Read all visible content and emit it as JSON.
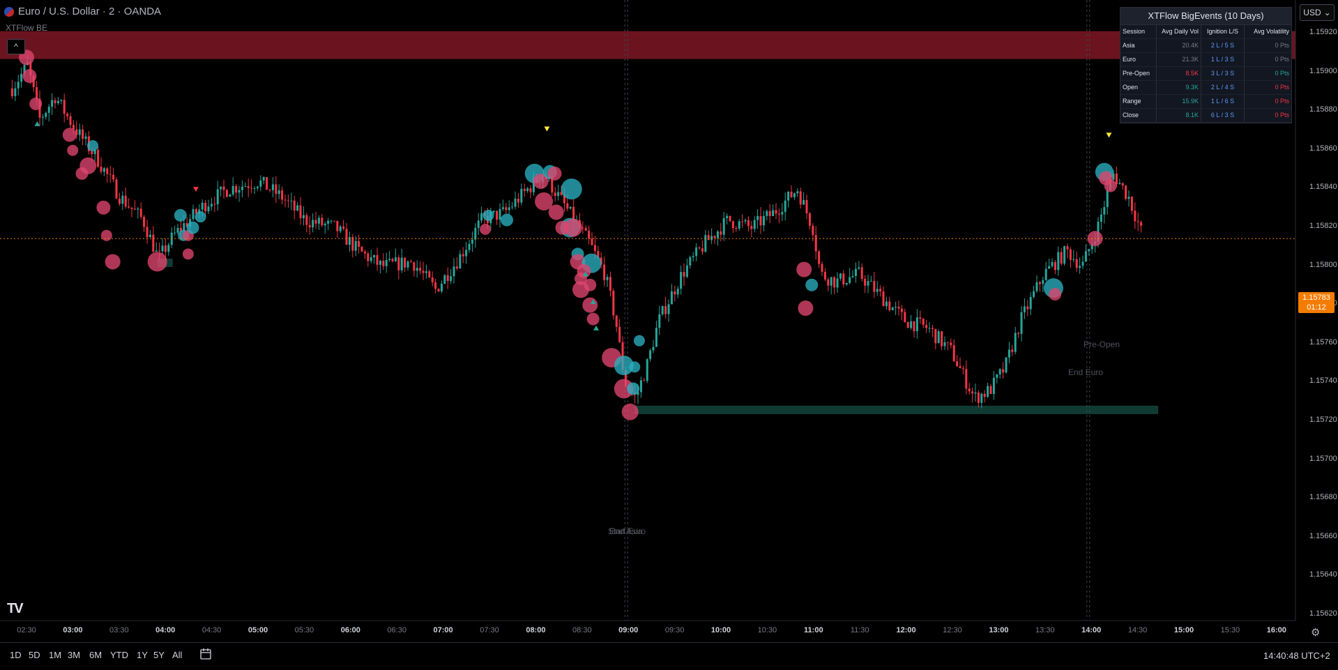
{
  "header": {
    "symbol_title": "Euro / U.S. Dollar · 2 · OANDA",
    "indicator_name": "XTFlow BE",
    "collapse_label": "^"
  },
  "currency_selector": {
    "value": "USD",
    "chevron": "⌄"
  },
  "price_axis": {
    "ticks": [
      "1.15920",
      "1.15900",
      "1.15880",
      "1.15860",
      "1.15840",
      "1.15820",
      "1.15800",
      "1.15780",
      "1.15760",
      "1.15740",
      "1.15720",
      "1.15700",
      "1.15680",
      "1.15660",
      "1.15640",
      "1.15620"
    ],
    "current_price": "1.15783",
    "countdown": "01:12"
  },
  "time_axis": {
    "ticks": [
      {
        "label": "02:30",
        "bold": false
      },
      {
        "label": "03:00",
        "bold": true
      },
      {
        "label": "03:30",
        "bold": false
      },
      {
        "label": "04:00",
        "bold": true
      },
      {
        "label": "04:30",
        "bold": false
      },
      {
        "label": "05:00",
        "bold": true
      },
      {
        "label": "05:30",
        "bold": false
      },
      {
        "label": "06:00",
        "bold": true
      },
      {
        "label": "06:30",
        "bold": false
      },
      {
        "label": "07:00",
        "bold": true
      },
      {
        "label": "07:30",
        "bold": false
      },
      {
        "label": "08:00",
        "bold": true
      },
      {
        "label": "08:30",
        "bold": false
      },
      {
        "label": "09:00",
        "bold": true
      },
      {
        "label": "09:30",
        "bold": false
      },
      {
        "label": "10:00",
        "bold": true
      },
      {
        "label": "10:30",
        "bold": false
      },
      {
        "label": "11:00",
        "bold": true
      },
      {
        "label": "11:30",
        "bold": false
      },
      {
        "label": "12:00",
        "bold": true
      },
      {
        "label": "12:30",
        "bold": false
      },
      {
        "label": "13:00",
        "bold": true
      },
      {
        "label": "13:30",
        "bold": false
      },
      {
        "label": "14:00",
        "bold": true
      },
      {
        "label": "14:30",
        "bold": false
      },
      {
        "label": "15:00",
        "bold": true
      },
      {
        "label": "15:30",
        "bold": false
      },
      {
        "label": "16:00",
        "bold": true
      }
    ]
  },
  "chart_labels": {
    "start_euro": "Start Euro",
    "end_asia": "End Asia",
    "pre_open": "Pre-Open",
    "end_euro": "End Euro"
  },
  "table": {
    "title": "XTFlow BigEvents (10 Days)",
    "headers": [
      "Session",
      "Avg Daily Vol",
      "Ignition L/S",
      "Avg Volatility"
    ],
    "rows": [
      {
        "session": "Asia",
        "vol": "20.4K",
        "vol_color": "#787b86",
        "ign": "2 L / 5 S",
        "vola": "0 Pts",
        "vola_color": "#787b86"
      },
      {
        "session": "Euro",
        "vol": "21.3K",
        "vol_color": "#787b86",
        "ign": "1 L / 3 S",
        "vola": "0 Pts",
        "vola_color": "#787b86"
      },
      {
        "session": "Pre-Open",
        "vol": "8.5K",
        "vol_color": "#f23645",
        "ign": "3 L / 3 S",
        "vola": "0 Pts",
        "vola_color": "#26a69a"
      },
      {
        "session": "Open",
        "vol": "9.3K",
        "vol_color": "#26a69a",
        "ign": "2 L / 4 S",
        "vola": "0 Pts",
        "vola_color": "#f23645"
      },
      {
        "session": "Range",
        "vol": "15.9K",
        "vol_color": "#26a69a",
        "ign": "1 L / 6 S",
        "vola": "0 Pts",
        "vola_color": "#f23645"
      },
      {
        "session": "Close",
        "vol": "8.1K",
        "vol_color": "#26a69a",
        "ign": "6 L / 3 S",
        "vola": "0 Pts",
        "vola_color": "#f23645"
      }
    ],
    "ign_color": "#5b9cf6"
  },
  "bottom_bar": {
    "ranges": [
      "1D",
      "5D",
      "1M",
      "3M",
      "6M",
      "YTD",
      "1Y",
      "5Y",
      "All"
    ],
    "clock": "14:40:48 UTC+2"
  },
  "colors": {
    "up": "#26a69a",
    "down": "#f23645",
    "bubble_red": "#e0456e",
    "bubble_teal": "#2ab0c0",
    "resistance_zone": "#6b1420",
    "support_zone": "#0f3b33",
    "current_price": "#f57c00"
  },
  "chart_data": {
    "type": "candlestick",
    "symbol": "Euro / U.S. Dollar",
    "timeframe": "2",
    "ylim": [
      1.1561,
      1.15935
    ],
    "x_range": [
      "02:20",
      "16:05"
    ],
    "path_points": [
      [
        "02:20",
        1.1588
      ],
      [
        "02:30",
        1.15895
      ],
      [
        "02:38",
        1.1586
      ],
      [
        "02:48",
        1.15875
      ],
      [
        "03:00",
        1.15855
      ],
      [
        "03:15",
        1.15835
      ],
      [
        "03:30",
        1.1581
      ],
      [
        "03:45",
        1.15795
      ],
      [
        "03:55",
        1.1577
      ],
      [
        "04:05",
        1.15785
      ],
      [
        "04:15",
        1.15795
      ],
      [
        "04:25",
        1.15805
      ],
      [
        "04:40",
        1.15815
      ],
      [
        "05:00",
        1.1582
      ],
      [
        "05:15",
        1.1581
      ],
      [
        "05:30",
        1.15795
      ],
      [
        "05:50",
        1.1579
      ],
      [
        "06:05",
        1.15775
      ],
      [
        "06:20",
        1.15765
      ],
      [
        "06:40",
        1.15768
      ],
      [
        "06:55",
        1.1575
      ],
      [
        "07:10",
        1.1577
      ],
      [
        "07:25",
        1.15795
      ],
      [
        "07:40",
        1.158
      ],
      [
        "07:55",
        1.15815
      ],
      [
        "08:05",
        1.15825
      ],
      [
        "08:15",
        1.1581
      ],
      [
        "08:25",
        1.15795
      ],
      [
        "08:35",
        1.1578
      ],
      [
        "08:45",
        1.1576
      ],
      [
        "08:52",
        1.1573
      ],
      [
        "08:58",
        1.1569
      ],
      [
        "09:05",
        1.1568
      ],
      [
        "09:12",
        1.157
      ],
      [
        "09:20",
        1.1573
      ],
      [
        "09:35",
        1.1576
      ],
      [
        "09:50",
        1.1578
      ],
      [
        "10:05",
        1.15795
      ],
      [
        "10:20",
        1.1579
      ],
      [
        "10:35",
        1.158
      ],
      [
        "10:50",
        1.15815
      ],
      [
        "11:00",
        1.1579
      ],
      [
        "11:05",
        1.1576
      ],
      [
        "11:15",
        1.15755
      ],
      [
        "11:30",
        1.1576
      ],
      [
        "11:45",
        1.15745
      ],
      [
        "12:00",
        1.1573
      ],
      [
        "12:15",
        1.15725
      ],
      [
        "12:30",
        1.1571
      ],
      [
        "12:45",
        1.1568
      ],
      [
        "12:55",
        1.15685
      ],
      [
        "13:05",
        1.157
      ],
      [
        "13:15",
        1.1573
      ],
      [
        "13:30",
        1.1576
      ],
      [
        "13:45",
        1.15775
      ],
      [
        "13:55",
        1.15765
      ],
      [
        "14:05",
        1.1579
      ],
      [
        "14:15",
        1.15825
      ],
      [
        "14:25",
        1.1581
      ],
      [
        "14:35",
        1.15783
      ]
    ],
    "current_price": 1.15783,
    "zones": [
      {
        "type": "resistance",
        "from": "02:20",
        "to": "15:00",
        "low": 1.15899,
        "high": 1.15917
      },
      {
        "type": "support",
        "from": "09:05",
        "to": "14:45",
        "low": 1.15671,
        "high": 1.15675
      },
      {
        "type": "support",
        "from": "03:55",
        "to": "04:05",
        "low": 1.15768,
        "high": 1.1577
      }
    ],
    "session_lines": [
      "09:00",
      "14:00"
    ],
    "bubbles": [
      {
        "t": "02:30",
        "p": 1.159,
        "r": 11,
        "c": "red"
      },
      {
        "t": "02:32",
        "p": 1.15888,
        "r": 10,
        "c": "red"
      },
      {
        "t": "02:36",
        "p": 1.1587,
        "r": 9,
        "c": "red"
      },
      {
        "t": "02:58",
        "p": 1.1585,
        "r": 10,
        "c": "red"
      },
      {
        "t": "03:00",
        "p": 1.1584,
        "r": 8,
        "c": "red"
      },
      {
        "t": "03:13",
        "p": 1.15843,
        "r": 8,
        "c": "teal"
      },
      {
        "t": "03:10",
        "p": 1.1583,
        "r": 12,
        "c": "red"
      },
      {
        "t": "03:06",
        "p": 1.15825,
        "r": 9,
        "c": "red"
      },
      {
        "t": "03:20",
        "p": 1.15803,
        "r": 10,
        "c": "red"
      },
      {
        "t": "03:22",
        "p": 1.15785,
        "r": 8,
        "c": "red"
      },
      {
        "t": "03:26",
        "p": 1.15768,
        "r": 11,
        "c": "red"
      },
      {
        "t": "03:55",
        "p": 1.15768,
        "r": 14,
        "c": "red"
      },
      {
        "t": "04:10",
        "p": 1.15798,
        "r": 9,
        "c": "teal"
      },
      {
        "t": "04:12",
        "p": 1.15785,
        "r": 8,
        "c": "teal"
      },
      {
        "t": "04:15",
        "p": 1.15785,
        "r": 8,
        "c": "red"
      },
      {
        "t": "04:18",
        "p": 1.1579,
        "r": 9,
        "c": "teal"
      },
      {
        "t": "04:23",
        "p": 1.15797,
        "r": 8,
        "c": "teal"
      },
      {
        "t": "04:15",
        "p": 1.15773,
        "r": 8,
        "c": "red"
      },
      {
        "t": "07:30",
        "p": 1.15798,
        "r": 8,
        "c": "teal"
      },
      {
        "t": "07:28",
        "p": 1.15789,
        "r": 8,
        "c": "red"
      },
      {
        "t": "07:42",
        "p": 1.15795,
        "r": 9,
        "c": "teal"
      },
      {
        "t": "08:00",
        "p": 1.15825,
        "r": 14,
        "c": "teal"
      },
      {
        "t": "08:04",
        "p": 1.1582,
        "r": 11,
        "c": "red"
      },
      {
        "t": "08:10",
        "p": 1.15826,
        "r": 10,
        "c": "teal"
      },
      {
        "t": "08:13",
        "p": 1.15825,
        "r": 10,
        "c": "red"
      },
      {
        "t": "08:06",
        "p": 1.15807,
        "r": 13,
        "c": "red"
      },
      {
        "t": "08:14",
        "p": 1.158,
        "r": 11,
        "c": "red"
      },
      {
        "t": "08:24",
        "p": 1.15815,
        "r": 15,
        "c": "teal"
      },
      {
        "t": "08:23",
        "p": 1.1579,
        "r": 14,
        "c": "teal"
      },
      {
        "t": "08:18",
        "p": 1.1579,
        "r": 10,
        "c": "red"
      },
      {
        "t": "08:25",
        "p": 1.1579,
        "r": 13,
        "c": "red"
      },
      {
        "t": "08:28",
        "p": 1.15773,
        "r": 9,
        "c": "teal"
      },
      {
        "t": "08:28",
        "p": 1.15768,
        "r": 11,
        "c": "red"
      },
      {
        "t": "08:37",
        "p": 1.15767,
        "r": 14,
        "c": "teal"
      },
      {
        "t": "08:32",
        "p": 1.15762,
        "r": 10,
        "c": "red"
      },
      {
        "t": "08:30",
        "p": 1.15757,
        "r": 9,
        "c": "red"
      },
      {
        "t": "08:36",
        "p": 1.15753,
        "r": 9,
        "c": "red"
      },
      {
        "t": "08:30",
        "p": 1.1575,
        "r": 12,
        "c": "red"
      },
      {
        "t": "08:36",
        "p": 1.1574,
        "r": 11,
        "c": "red"
      },
      {
        "t": "08:38",
        "p": 1.15731,
        "r": 9,
        "c": "red"
      },
      {
        "t": "08:50",
        "p": 1.15706,
        "r": 14,
        "c": "red"
      },
      {
        "t": "08:58",
        "p": 1.15701,
        "r": 14,
        "c": "teal"
      },
      {
        "t": "09:05",
        "p": 1.157,
        "r": 8,
        "c": "teal"
      },
      {
        "t": "09:08",
        "p": 1.15717,
        "r": 8,
        "c": "teal"
      },
      {
        "t": "08:58",
        "p": 1.15686,
        "r": 14,
        "c": "red"
      },
      {
        "t": "09:04",
        "p": 1.15686,
        "r": 9,
        "c": "teal"
      },
      {
        "t": "09:02",
        "p": 1.15671,
        "r": 12,
        "c": "red"
      },
      {
        "t": "10:55",
        "p": 1.15763,
        "r": 11,
        "c": "red"
      },
      {
        "t": "11:00",
        "p": 1.15753,
        "r": 9,
        "c": "teal"
      },
      {
        "t": "10:56",
        "p": 1.15738,
        "r": 11,
        "c": "red"
      },
      {
        "t": "13:37",
        "p": 1.15751,
        "r": 14,
        "c": "teal"
      },
      {
        "t": "13:38",
        "p": 1.15747,
        "r": 9,
        "c": "red"
      },
      {
        "t": "14:04",
        "p": 1.15783,
        "r": 11,
        "c": "red"
      },
      {
        "t": "14:10",
        "p": 1.15826,
        "r": 13,
        "c": "teal"
      },
      {
        "t": "14:11",
        "p": 1.15822,
        "r": 10,
        "c": "red"
      },
      {
        "t": "14:14",
        "p": 1.15817,
        "r": 9,
        "c": "red"
      }
    ],
    "markers": [
      {
        "t": "02:37",
        "p": 1.15857,
        "kind": "up"
      },
      {
        "t": "04:20",
        "p": 1.15815,
        "kind": "down"
      },
      {
        "t": "08:08",
        "p": 1.15854,
        "kind": "down-yellow"
      },
      {
        "t": "08:33",
        "p": 1.1576,
        "kind": "up"
      },
      {
        "t": "08:38",
        "p": 1.15742,
        "kind": "up"
      },
      {
        "t": "08:40",
        "p": 1.15725,
        "kind": "up"
      },
      {
        "t": "14:13",
        "p": 1.1585,
        "kind": "down-yellow"
      }
    ]
  }
}
